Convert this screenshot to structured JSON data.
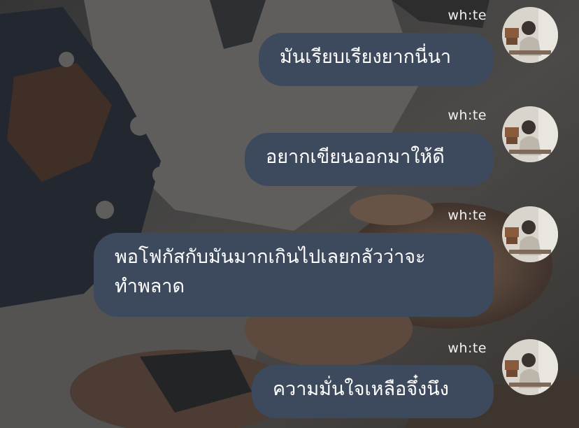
{
  "chat": {
    "messages": [
      {
        "sender": "wh:te",
        "text": "มันเรียบเรียงยากนี่นา"
      },
      {
        "sender": "wh:te",
        "text": "อยากเขียนออกมาให้ดี"
      },
      {
        "sender": "wh:te",
        "text": "พอโฟกัสกับมันมากเกินไปเลยกลัวว่าจะ\nทำพลาด"
      },
      {
        "sender": "wh:te",
        "text": "ความมั่นใจเหลือจึ๋งนึง"
      }
    ],
    "bubble_color": "#3d4a5e",
    "text_color": "#ffffff",
    "avatar_icon": "profile-photo-person-at-desk"
  }
}
